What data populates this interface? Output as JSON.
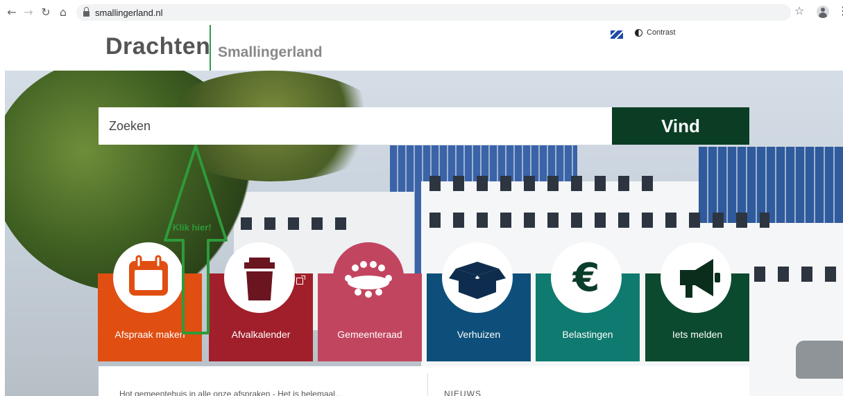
{
  "browser": {
    "url": "smallingerland.nl",
    "icons": {
      "back": "arrow-left-icon",
      "forward": "arrow-right-icon",
      "reload": "reload-icon",
      "home": "home-icon",
      "lock": "lock-icon",
      "star": "star-icon",
      "profile": "profile-icon",
      "menu": "menu-dots-icon"
    }
  },
  "header": {
    "logo_main": "Drachten",
    "logo_sub": "Smallingerland",
    "contrast_label": "Contrast",
    "accent_color": "#2e9a4f"
  },
  "search": {
    "placeholder": "Zoeken",
    "button_label": "Vind",
    "button_color": "#0a3d24"
  },
  "annotation": {
    "label": "Klik hier!",
    "color": "#2e9a3a"
  },
  "tiles": [
    {
      "label": "Afspraak maken",
      "icon": "calendar-icon",
      "color": "#e04e12"
    },
    {
      "label": "Afvalkalender",
      "icon": "trash-bin-icon",
      "color": "#a01f2b",
      "external": true
    },
    {
      "label": "Gemeenteraad",
      "icon": "council-people-icon",
      "color": "#c2455f"
    },
    {
      "label": "Verhuizen",
      "icon": "moving-box-icon",
      "color": "#0d4f7a"
    },
    {
      "label": "Belastingen",
      "icon": "euro-icon",
      "color": "#0f7a6f"
    },
    {
      "label": "Iets melden",
      "icon": "megaphone-icon",
      "color": "#0b4a2e"
    }
  ],
  "strip": {
    "text": "Hot gemeentehuis in alle onze afspraken - Het is helemaal...",
    "news": "NIEUWS"
  }
}
